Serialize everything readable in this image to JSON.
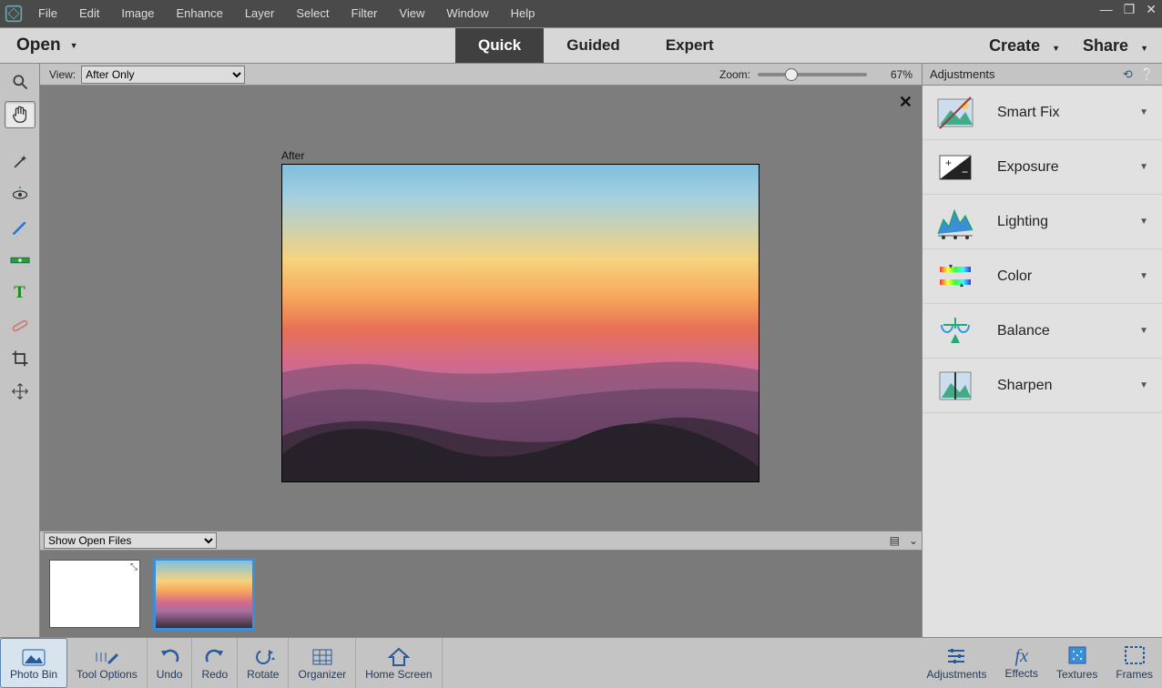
{
  "menu": {
    "items": [
      "File",
      "Edit",
      "Image",
      "Enhance",
      "Layer",
      "Select",
      "Filter",
      "View",
      "Window",
      "Help"
    ]
  },
  "modebar": {
    "open": "Open",
    "modes": [
      "Quick",
      "Guided",
      "Expert"
    ],
    "active": "Quick",
    "create": "Create",
    "share": "Share"
  },
  "view": {
    "label": "View:",
    "selected": "After Only"
  },
  "zoom": {
    "label": "Zoom:",
    "pct": "67%",
    "pos": 30
  },
  "canvas": {
    "afterLabel": "After"
  },
  "bin": {
    "selector": "Show Open Files"
  },
  "panel": {
    "title": "Adjustments",
    "items": [
      {
        "label": "Smart Fix",
        "icon": "smartfix"
      },
      {
        "label": "Exposure",
        "icon": "exposure"
      },
      {
        "label": "Lighting",
        "icon": "lighting"
      },
      {
        "label": "Color",
        "icon": "color"
      },
      {
        "label": "Balance",
        "icon": "balance"
      },
      {
        "label": "Sharpen",
        "icon": "sharpen"
      }
    ]
  },
  "bottom": {
    "left": [
      {
        "label": "Photo Bin",
        "key": "photobin",
        "active": true
      },
      {
        "label": "Tool Options",
        "key": "tooloptions"
      },
      {
        "label": "Undo",
        "key": "undo"
      },
      {
        "label": "Redo",
        "key": "redo"
      },
      {
        "label": "Rotate",
        "key": "rotate"
      },
      {
        "label": "Organizer",
        "key": "organizer"
      },
      {
        "label": "Home Screen",
        "key": "home"
      }
    ],
    "right": [
      {
        "label": "Adjustments",
        "key": "adjustments"
      },
      {
        "label": "Effects",
        "key": "effects"
      },
      {
        "label": "Textures",
        "key": "textures"
      },
      {
        "label": "Frames",
        "key": "frames"
      }
    ]
  },
  "tools": [
    {
      "name": "zoom",
      "glyph": "zoom"
    },
    {
      "name": "hand",
      "glyph": "hand",
      "active": true
    },
    {
      "name": "quicksel",
      "glyph": "wand"
    },
    {
      "name": "redeye",
      "glyph": "eye"
    },
    {
      "name": "whiten",
      "glyph": "brush"
    },
    {
      "name": "straighten",
      "glyph": "level"
    },
    {
      "name": "text",
      "glyph": "T"
    },
    {
      "name": "spotheal",
      "glyph": "bandaid"
    },
    {
      "name": "crop",
      "glyph": "crop"
    },
    {
      "name": "move",
      "glyph": "move"
    }
  ]
}
